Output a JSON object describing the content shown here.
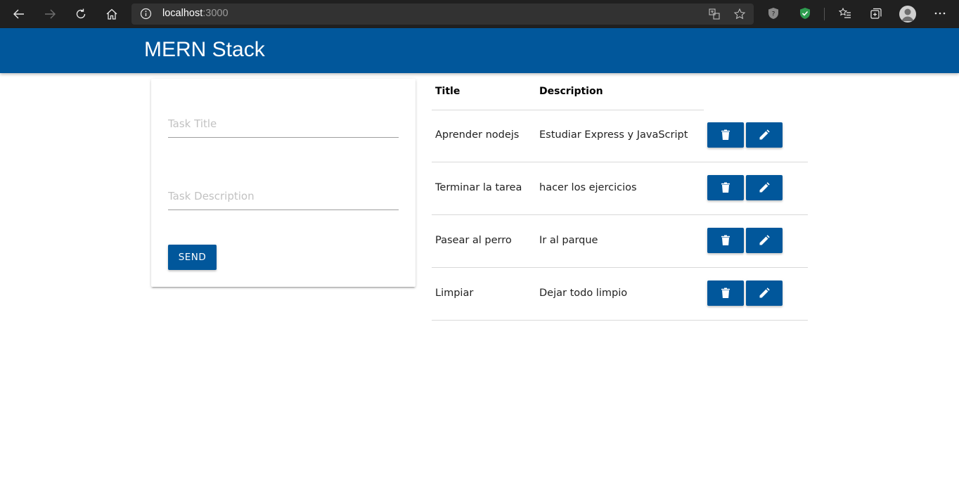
{
  "browser": {
    "url_host": "localhost",
    "url_port": ":3000"
  },
  "header": {
    "brand": "MERN Stack"
  },
  "form": {
    "title_placeholder": "Task Title",
    "description_placeholder": "Task Description",
    "title_value": "",
    "description_value": "",
    "send_label": "SEND"
  },
  "table": {
    "headers": {
      "title": "Title",
      "description": "Description"
    },
    "rows": [
      {
        "title": "Aprender nodejs",
        "description": "Estudiar Express y JavaScript"
      },
      {
        "title": "Terminar la tarea",
        "description": "hacer los ejercicios"
      },
      {
        "title": "Pasear al perro",
        "description": "Ir al parque"
      },
      {
        "title": "Limpiar",
        "description": "Dejar todo limpio"
      }
    ],
    "delete_icon": "delete-icon",
    "edit_icon": "edit-icon"
  },
  "colors": {
    "primary": "#01579b",
    "browser_bg": "#202020",
    "address_bg": "#323232"
  }
}
